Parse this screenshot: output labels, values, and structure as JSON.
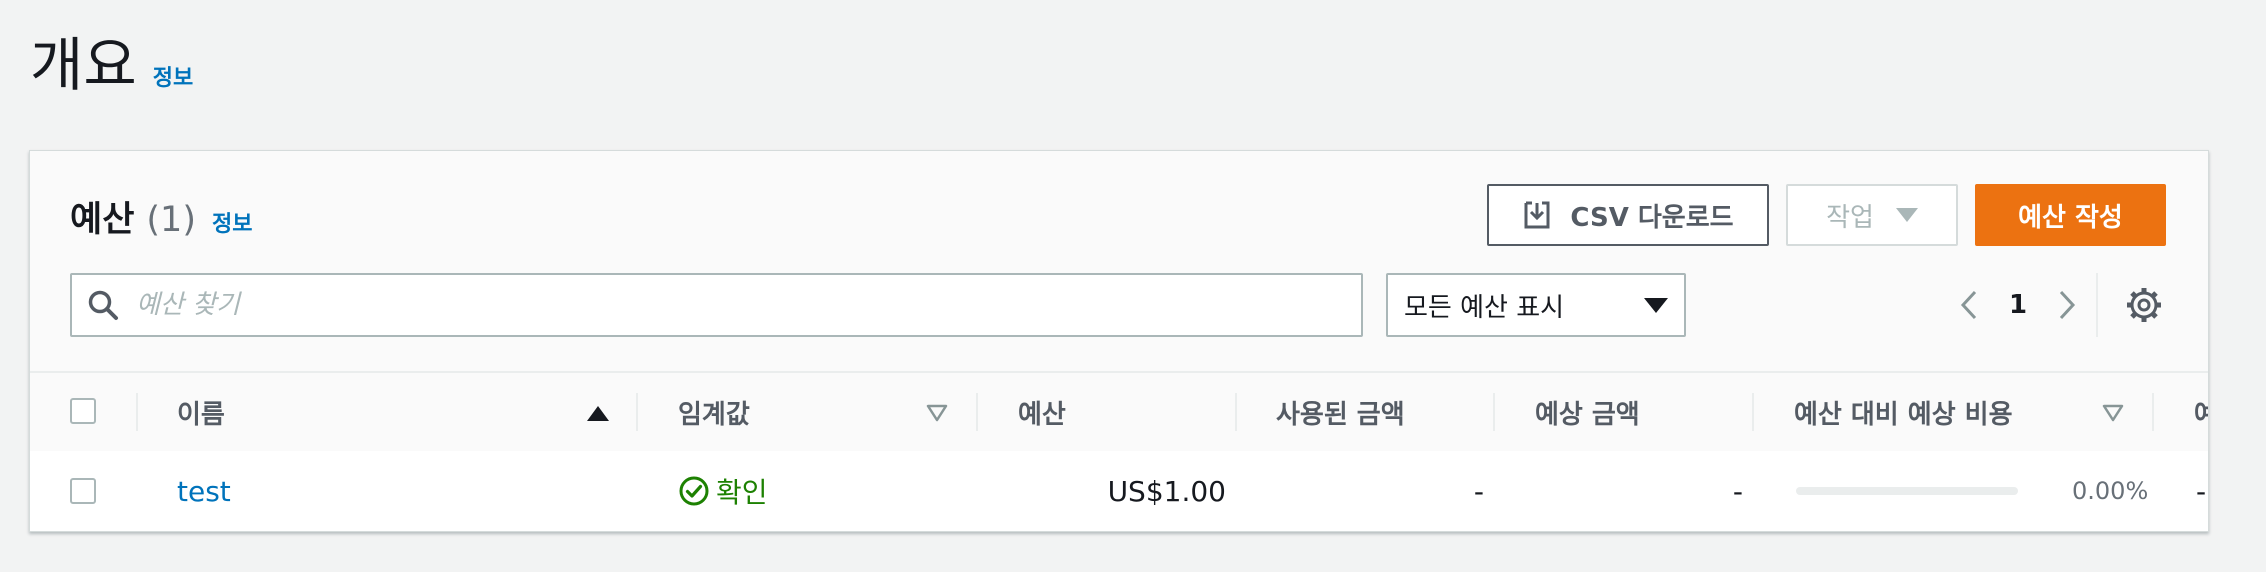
{
  "header": {
    "title": "개요",
    "info_link": "정보"
  },
  "table": {
    "title": "예산",
    "count": "(1)",
    "info_link": "정보",
    "toolbar": {
      "csv_download_label": "CSV 다운로드",
      "actions_label": "작업",
      "create_label": "예산 작성"
    },
    "search": {
      "placeholder": "예산 찾기",
      "value": ""
    },
    "filter": {
      "selected": "모든 예산 표시"
    },
    "pagination": {
      "current_page": "1"
    },
    "columns": [
      {
        "label": "이름",
        "sort": "ascending"
      },
      {
        "label": "임계값",
        "sort": "sortable"
      },
      {
        "label": "예산"
      },
      {
        "label": "사용된 금액"
      },
      {
        "label": "예상 금액"
      },
      {
        "label": "예산 대비 예상 비용",
        "sort": "sortable"
      },
      {
        "label": "예"
      }
    ],
    "rows": [
      {
        "name": "test",
        "threshold_status": "확인",
        "budget": "US$1.00",
        "amount_used": "-",
        "forecasted_amount": "-",
        "forecast_vs_budget": "0.00%",
        "forecast_vs_budget_fraction": 0,
        "truncated_cell": "-"
      }
    ]
  },
  "colors": {
    "accent": "#ec7211",
    "link": "#0073bb",
    "success": "#1d8102"
  },
  "icons": [
    "download-icon",
    "caret-down-icon",
    "search-icon",
    "chevron-left-icon",
    "chevron-right-icon",
    "gear-icon",
    "sort-ascending-icon",
    "sort-icon",
    "check-circle-icon"
  ]
}
